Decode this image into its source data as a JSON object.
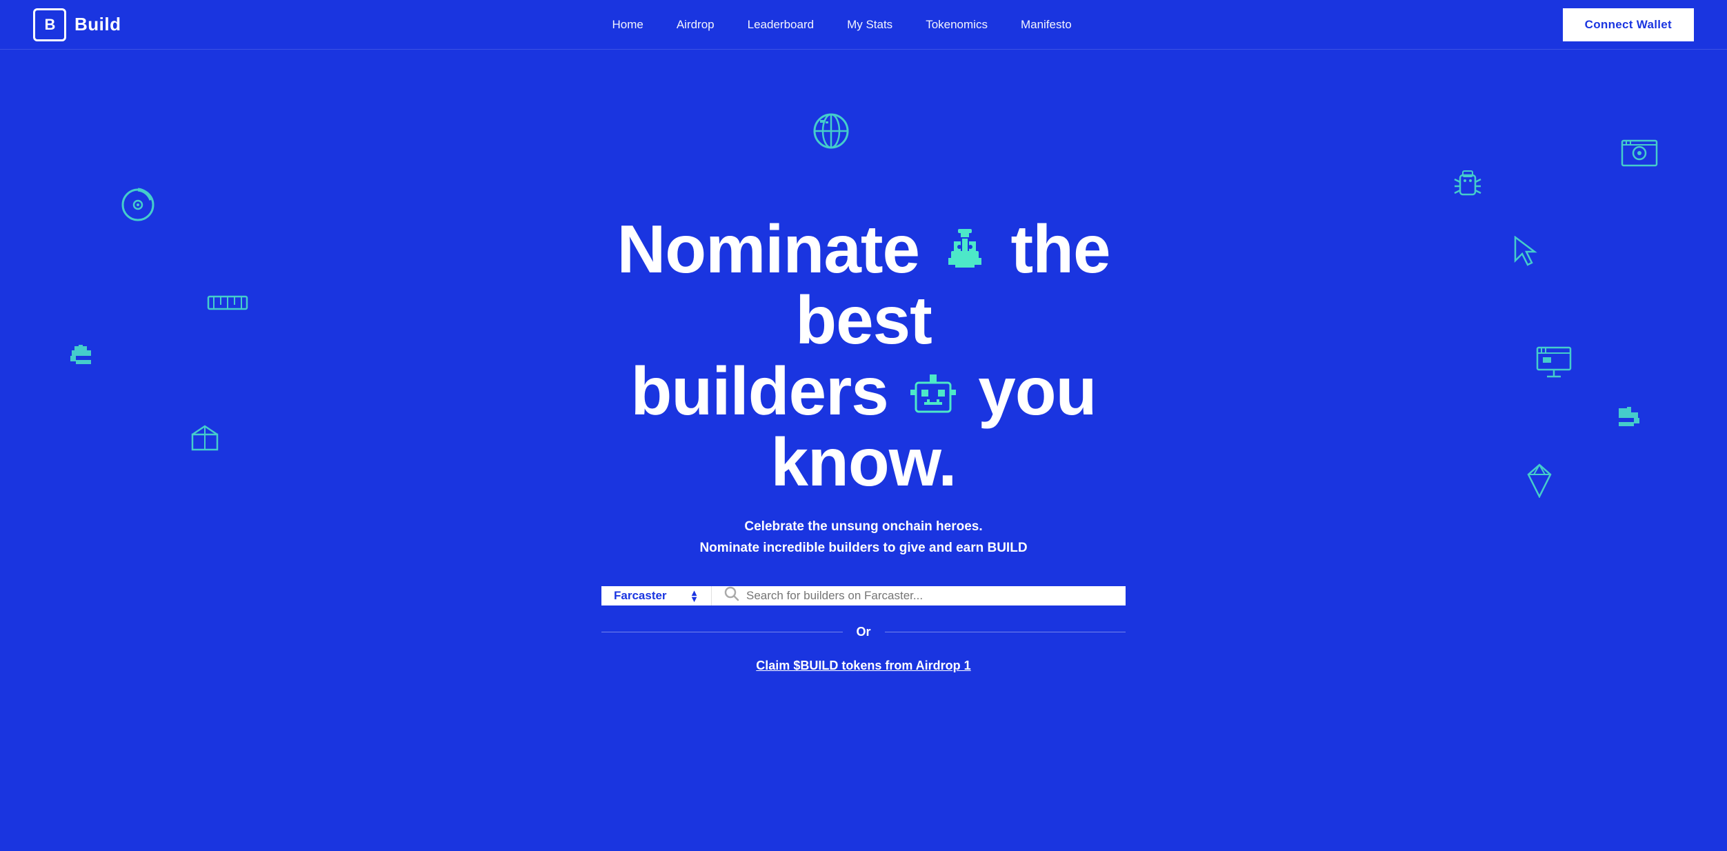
{
  "nav": {
    "logo_box": "B",
    "logo_text": "Build",
    "links": [
      {
        "id": "home",
        "label": "Home"
      },
      {
        "id": "airdrop",
        "label": "Airdrop"
      },
      {
        "id": "leaderboard",
        "label": "Leaderboard"
      },
      {
        "id": "my-stats",
        "label": "My Stats"
      },
      {
        "id": "tokenomics",
        "label": "Tokenomics"
      },
      {
        "id": "manifesto",
        "label": "Manifesto"
      }
    ],
    "connect_wallet": "Connect Wallet"
  },
  "hero": {
    "title_line1": "Nominate",
    "title_line2": "the best",
    "title_line3": "builders",
    "title_line4": "you know.",
    "subtitle_line1": "Celebrate the unsung onchain heroes.",
    "subtitle_line2": "Nominate incredible builders to give and earn BUILD",
    "platform_label": "Farcaster",
    "search_placeholder": "Search for builders on Farcaster...",
    "or_text": "Or",
    "claim_link": "Claim $BUILD tokens from Airdrop 1"
  },
  "colors": {
    "bg": "#1a35e0",
    "accent": "#4de8c8",
    "white": "#ffffff",
    "btn_bg": "#ffffff",
    "btn_text": "#1a35e0"
  }
}
